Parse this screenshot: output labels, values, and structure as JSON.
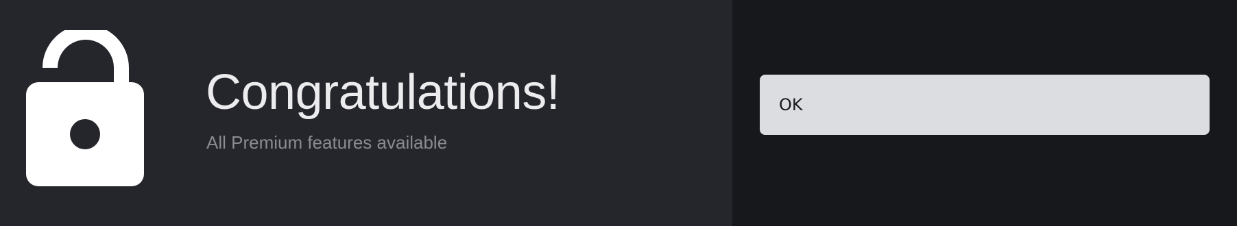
{
  "dialog": {
    "icon": "unlocked-padlock-icon",
    "title": "Congratulations!",
    "subtitle": "All Premium features available",
    "ok_label": "OK"
  },
  "colors": {
    "left_panel_bg": "#25262b",
    "right_panel_bg": "#17181c",
    "title_text": "#ececee",
    "subtitle_text": "#8b8c91",
    "button_bg": "#dcdde1",
    "button_text": "#1a1b1e",
    "icon": "#ffffff"
  }
}
